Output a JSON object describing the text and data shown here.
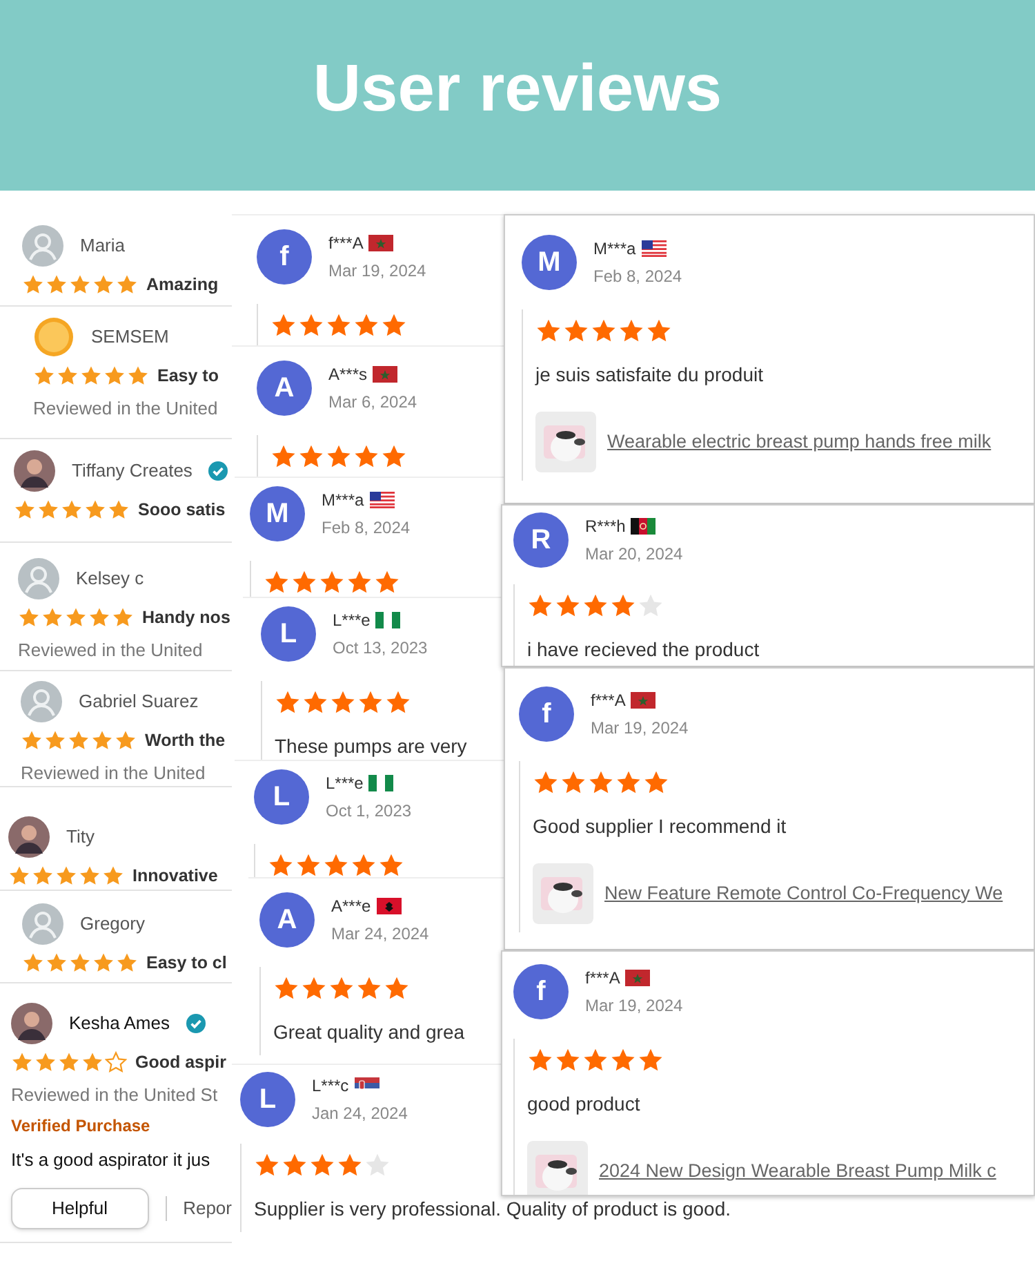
{
  "header": {
    "title": "User reviews"
  },
  "amazon_reviews": [
    {
      "name": "Maria",
      "avatar": {
        "kind": "default"
      },
      "verified": false,
      "stars": 5,
      "title": "Amazing"
    },
    {
      "name": "SEMSEM",
      "avatar": {
        "kind": "emoji"
      },
      "verified": false,
      "stars": 5,
      "title": "Easy to",
      "region": "Reviewed in the United"
    },
    {
      "name": "Tiffany Creates",
      "verified": true,
      "stars": 5,
      "title": "Sooo satis"
    },
    {
      "name": "Kelsey c",
      "avatar": {
        "kind": "default"
      },
      "verified": false,
      "stars": 5,
      "title": "Handy nos",
      "region": "Reviewed in the United"
    },
    {
      "name": "Gabriel Suarez",
      "avatar": {
        "kind": "default"
      },
      "verified": false,
      "stars": 5,
      "title": "Worth the",
      "region": "Reviewed in the United"
    },
    {
      "name": "Tity",
      "verified": false,
      "stars": 5,
      "title": "Innovative"
    },
    {
      "name": "Gregory",
      "avatar": {
        "kind": "default"
      },
      "verified": false,
      "stars": 5,
      "title": "Easy to cl"
    },
    {
      "name": "Kesha Ames",
      "verified": true,
      "stars": 4,
      "title": "Good aspir",
      "region": "Reviewed in the United St",
      "badge": "Verified Purchase",
      "text": "It's a good aspirator it jus",
      "helpful_button": "Helpful",
      "report_link": "Repor"
    }
  ],
  "supplier_reviews_middle": [
    {
      "initial": "f",
      "name": "f***A",
      "flag": {
        "kind": "morocco"
      },
      "date": "Mar 19, 2024",
      "stars": 5
    },
    {
      "initial": "A",
      "name": "A***s",
      "flag": {
        "kind": "morocco"
      },
      "date": "Mar 6, 2024",
      "stars": 5
    },
    {
      "initial": "M",
      "name": "M***a",
      "flag": {
        "kind": "us"
      },
      "date": "Feb 8, 2024",
      "stars": 5
    },
    {
      "initial": "L",
      "name": "L***e",
      "flag": {
        "kind": "nigeria"
      },
      "date": "Oct 13, 2023",
      "stars": 5,
      "text": "These pumps are very"
    },
    {
      "initial": "L",
      "name": "L***e",
      "flag": {
        "kind": "nigeria"
      },
      "date": "Oct 1, 2023",
      "stars": 5
    },
    {
      "initial": "A",
      "name": "A***e",
      "flag": {
        "kind": "albania"
      },
      "date": "Mar 24, 2024",
      "stars": 5,
      "text": "Great quality and grea"
    },
    {
      "initial": "L",
      "name": "L***c",
      "flag": {
        "kind": "serbia"
      },
      "date": "Jan 24, 2024",
      "stars": 4,
      "text": "Supplier is very professional. Quality of product is good."
    }
  ],
  "supplier_reviews_right": [
    {
      "initial": "M",
      "name": "M***a",
      "flag": {
        "kind": "us"
      },
      "date": "Feb 8, 2024",
      "stars": 5,
      "text": "je suis satisfaite du produit",
      "product": "Wearable electric breast pump hands free milk"
    },
    {
      "initial": "R",
      "name": "R***h",
      "flag": {
        "kind": "afghanistan"
      },
      "date": "Mar 20, 2024",
      "stars": 4,
      "text": "i have recieved the product"
    },
    {
      "initial": "f",
      "name": "f***A",
      "flag": {
        "kind": "morocco"
      },
      "date": "Mar 19, 2024",
      "stars": 5,
      "text": "Good supplier I recommend it",
      "product": "New Feature Remote Control Co-Frequency We"
    },
    {
      "initial": "f",
      "name": "f***A",
      "flag": {
        "kind": "morocco"
      },
      "date": "Mar 19, 2024",
      "stars": 5,
      "text": "good product",
      "product": "2024 New Design Wearable Breast Pump Milk c"
    }
  ]
}
